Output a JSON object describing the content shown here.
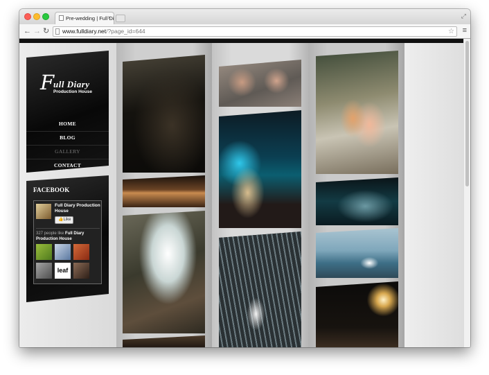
{
  "browser": {
    "tab_title": "Pre-wedding | Full Diary P",
    "tab_close": "×",
    "url_host": "www.fulldiary.net",
    "url_path": "/?page_id=644"
  },
  "site": {
    "logo_script": "F",
    "logo_title": "ull Diary",
    "logo_subtitle": "Production House",
    "nav": [
      {
        "label": "HOME"
      },
      {
        "label": "BLOG"
      },
      {
        "label": "GALLERY"
      },
      {
        "label": "CONTACT"
      }
    ]
  },
  "facebook": {
    "heading": "FACEBOOK",
    "page_name": "Full Diary Production House",
    "like_label": "Like",
    "likes_count": "327 people like",
    "likes_page": "Full Diary Production House",
    "brand_logo_text": "leaf"
  },
  "icons": [
    "back-icon",
    "forward-icon",
    "reload-icon",
    "page-icon",
    "star-icon",
    "menu-icon",
    "like-thumb-icon"
  ],
  "colors": {
    "panel_black": "#0b0b0b",
    "nav_active": "#ffffff",
    "nav_current": "#777777"
  }
}
